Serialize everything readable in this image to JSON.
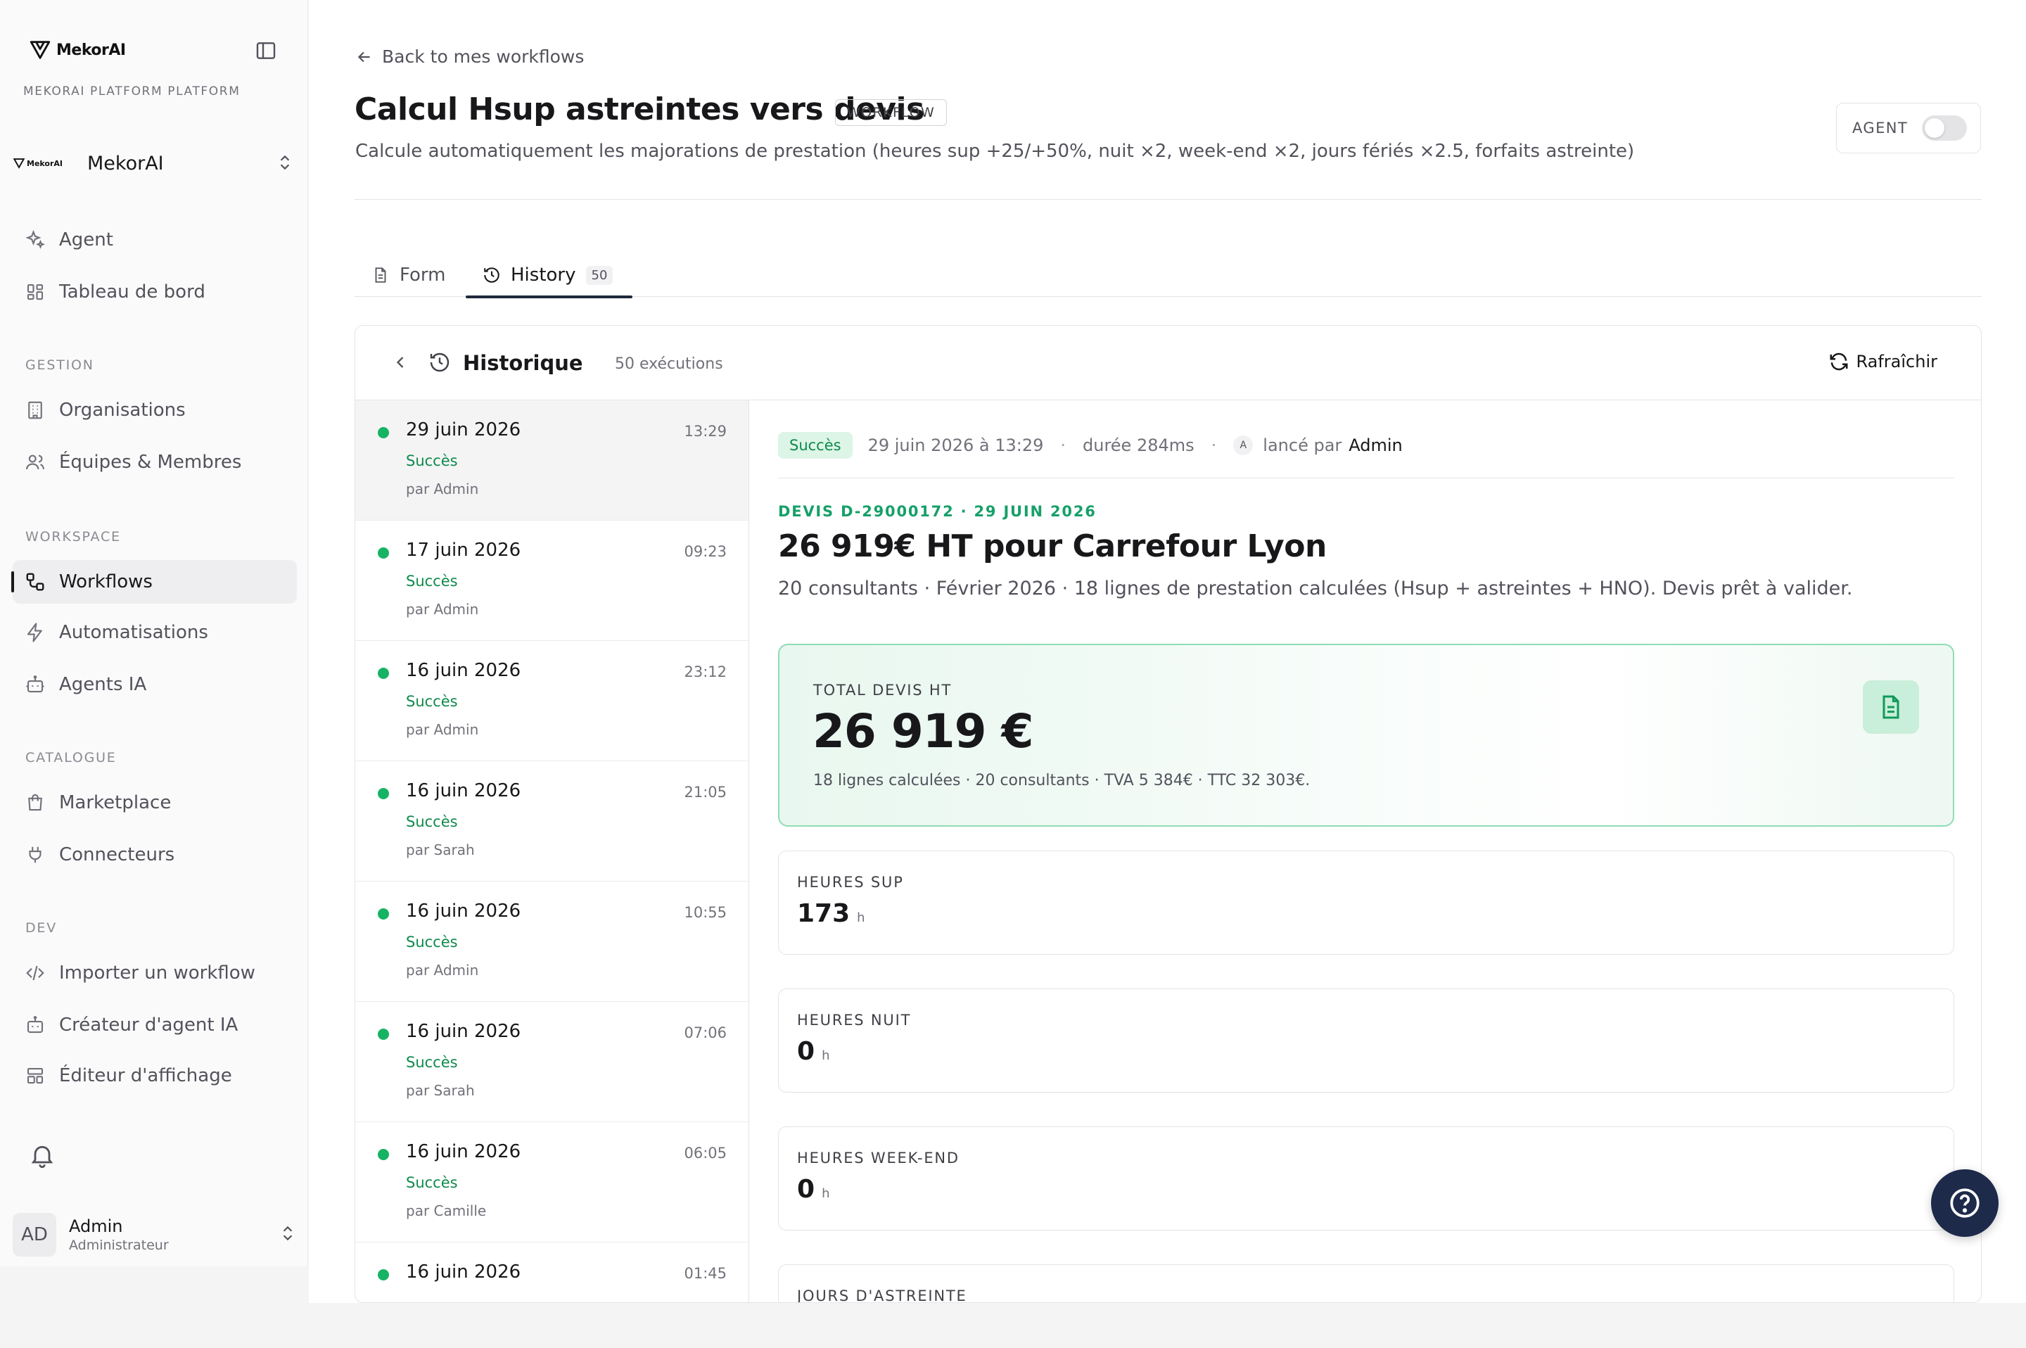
{
  "sidebar": {
    "brand": "MekorAI",
    "platform_label": "MEKORAI PLATFORM PLATFORM",
    "org": {
      "logo_text": "MekorAI",
      "name": "MekorAI"
    },
    "top_items": [
      {
        "label": "Agent",
        "icon": "sparkles-icon"
      },
      {
        "label": "Tableau de bord",
        "icon": "dashboard-icon"
      }
    ],
    "sections": [
      {
        "label": "GESTION",
        "items": [
          {
            "label": "Organisations",
            "icon": "building-icon"
          },
          {
            "label": "Équipes & Membres",
            "icon": "users-icon"
          }
        ]
      },
      {
        "label": "WORKSPACE",
        "items": [
          {
            "label": "Workflows",
            "icon": "workflow-icon",
            "active": true
          },
          {
            "label": "Automatisations",
            "icon": "bolt-icon"
          },
          {
            "label": "Agents IA",
            "icon": "bot-icon"
          }
        ]
      },
      {
        "label": "CATALOGUE",
        "items": [
          {
            "label": "Marketplace",
            "icon": "bag-icon"
          },
          {
            "label": "Connecteurs",
            "icon": "plug-icon"
          }
        ]
      },
      {
        "label": "DEV",
        "items": [
          {
            "label": "Importer un workflow",
            "icon": "code-icon"
          },
          {
            "label": "Créateur d'agent IA",
            "icon": "bot-icon"
          },
          {
            "label": "Éditeur d'affichage",
            "icon": "layout-icon"
          }
        ]
      }
    ],
    "user": {
      "initials": "AD",
      "name": "Admin",
      "role": "Administrateur"
    }
  },
  "header": {
    "back_label": "Back to mes workflows",
    "title": "Calcul Hsup astreintes vers devis",
    "badge": "WORKFLOW",
    "description": "Calcule automatiquement les majorations de prestation (heures sup +25/+50%, nuit ×2, week-end ×2, jours fériés ×2.5, forfaits astreinte)",
    "agent_label": "AGENT"
  },
  "tabs": [
    {
      "label": "Form",
      "active": false
    },
    {
      "label": "History",
      "count": "50",
      "active": true
    }
  ],
  "history": {
    "title": "Historique",
    "count_label": "50 exécutions",
    "refresh_label": "Rafraîchir",
    "runs": [
      {
        "date": "29 juin 2026",
        "time": "13:29",
        "status": "Succès",
        "by": "par Admin",
        "selected": true
      },
      {
        "date": "17 juin 2026",
        "time": "09:23",
        "status": "Succès",
        "by": "par Admin"
      },
      {
        "date": "16 juin 2026",
        "time": "23:12",
        "status": "Succès",
        "by": "par Admin"
      },
      {
        "date": "16 juin 2026",
        "time": "21:05",
        "status": "Succès",
        "by": "par Sarah"
      },
      {
        "date": "16 juin 2026",
        "time": "10:55",
        "status": "Succès",
        "by": "par Admin"
      },
      {
        "date": "16 juin 2026",
        "time": "07:06",
        "status": "Succès",
        "by": "par Sarah"
      },
      {
        "date": "16 juin 2026",
        "time": "06:05",
        "status": "Succès",
        "by": "par Camille"
      },
      {
        "date": "16 juin 2026",
        "time": "01:45",
        "status": "Succès",
        "by": ""
      }
    ]
  },
  "detail": {
    "status": "Succès",
    "datetime": "29 juin 2026 à 13:29",
    "duration": "durée 284ms",
    "launched_avatar": "A",
    "launched_label": "lancé par",
    "launched_by": "Admin",
    "devis_ref": "DEVIS D-29000172 · 29 JUIN 2026",
    "title": "26 919€ HT pour Carrefour Lyon",
    "subtitle": "20 consultants · Février 2026 · 18 lignes de prestation calculées (Hsup + astreintes + HNO). Devis prêt à valider.",
    "total": {
      "label": "TOTAL DEVIS HT",
      "value": "26 919 €",
      "sub": "18 lignes calculées · 20 consultants · TVA 5 384€ · TTC 32 303€."
    },
    "stats": [
      {
        "label": "HEURES SUP",
        "value": "173",
        "unit": "h"
      },
      {
        "label": "HEURES NUIT",
        "value": "0",
        "unit": "h"
      },
      {
        "label": "HEURES WEEK-END",
        "value": "0",
        "unit": "h"
      },
      {
        "label": "JOURS D'ASTREINTE",
        "value": "",
        "unit": ""
      }
    ]
  },
  "colors": {
    "accent_green": "#16b364",
    "dark_navy": "#1e2a4a"
  }
}
